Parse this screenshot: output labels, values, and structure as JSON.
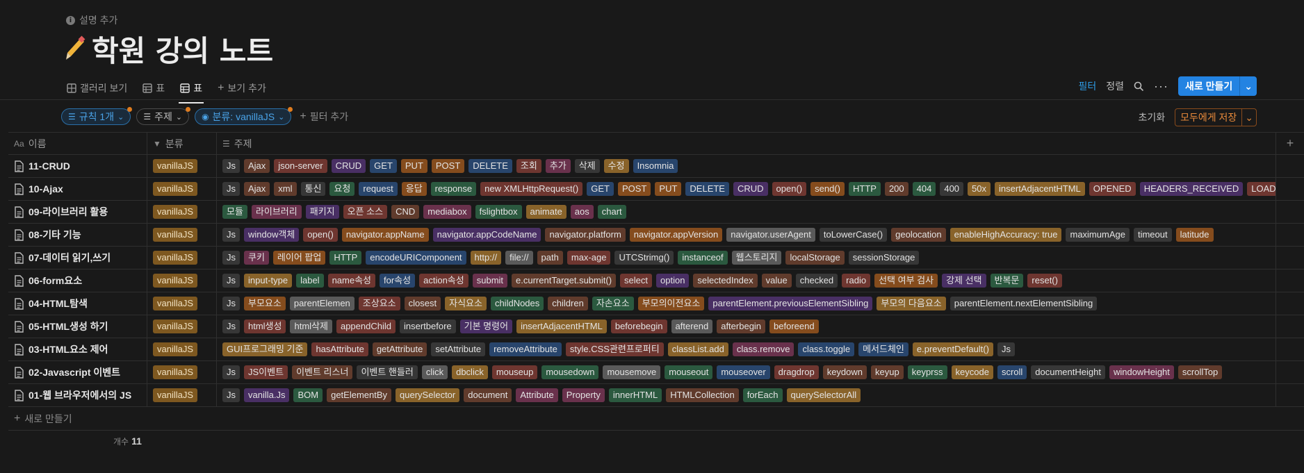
{
  "page": {
    "description_label": "설명 추가",
    "title": "학원 강의 노트"
  },
  "views": {
    "items": [
      {
        "label": "갤러리 보기",
        "icon": "gallery-icon",
        "active": false
      },
      {
        "label": "표",
        "icon": "table-icon",
        "active": false
      },
      {
        "label": "표",
        "icon": "table-icon",
        "active": true
      }
    ],
    "add_view": "보기 추가"
  },
  "toolbar": {
    "filter": "필터",
    "sort": "정렬",
    "new_button": "새로 만들기"
  },
  "filters": {
    "rules": "규칙 1개",
    "topic": "주제",
    "category": "분류: vanillaJS",
    "add_filter": "필터 추가",
    "reset": "초기화",
    "save": "모두에게 저장"
  },
  "table": {
    "headers": {
      "name": "이름",
      "category": "분류",
      "topic": "주제"
    },
    "rows": [
      {
        "name": "11-CRUD",
        "category": "vanillaJS",
        "tags": [
          [
            "Js",
            "default"
          ],
          [
            "Ajax",
            "brown"
          ],
          [
            "json-server",
            "red"
          ],
          [
            "CRUD",
            "purple"
          ],
          [
            "GET",
            "blue"
          ],
          [
            "PUT",
            "orange"
          ],
          [
            "POST",
            "orange"
          ],
          [
            "DELETE",
            "blue"
          ],
          [
            "조회",
            "red"
          ],
          [
            "추가",
            "pink"
          ],
          [
            "삭제",
            "default"
          ],
          [
            "수정",
            "yellow"
          ],
          [
            "Insomnia",
            "blue"
          ]
        ]
      },
      {
        "name": "10-Ajax",
        "category": "vanillaJS",
        "tags": [
          [
            "Js",
            "default"
          ],
          [
            "Ajax",
            "brown"
          ],
          [
            "xml",
            "brown"
          ],
          [
            "통신",
            "default"
          ],
          [
            "요청",
            "green"
          ],
          [
            "request",
            "blue"
          ],
          [
            "응답",
            "orange"
          ],
          [
            "response",
            "green"
          ],
          [
            "new XMLHttpRequest()",
            "red"
          ],
          [
            "GET",
            "blue"
          ],
          [
            "POST",
            "orange"
          ],
          [
            "PUT",
            "orange"
          ],
          [
            "DELETE",
            "blue"
          ],
          [
            "CRUD",
            "purple"
          ],
          [
            "open()",
            "red"
          ],
          [
            "send()",
            "orange"
          ],
          [
            "HTTP",
            "green"
          ],
          [
            "200",
            "brown"
          ],
          [
            "404",
            "green"
          ],
          [
            "400",
            "default"
          ],
          [
            "50x",
            "yellow"
          ],
          [
            "insertAdjacentHTML",
            "yellow"
          ],
          [
            "OPENED",
            "red"
          ],
          [
            "HEADERS_RECEIVED",
            "purple"
          ],
          [
            "LOADING",
            "red"
          ]
        ]
      },
      {
        "name": "09-라이브러리 활용",
        "category": "vanillaJS",
        "tags": [
          [
            "모듈",
            "green"
          ],
          [
            "라이브러리",
            "pink"
          ],
          [
            "패키지",
            "purple"
          ],
          [
            "오픈 소스",
            "red"
          ],
          [
            "CND",
            "brown"
          ],
          [
            "mediabox",
            "pink"
          ],
          [
            "fslightbox",
            "green"
          ],
          [
            "animate",
            "yellow"
          ],
          [
            "aos",
            "pink"
          ],
          [
            "chart",
            "green"
          ]
        ]
      },
      {
        "name": "08-기타 기능",
        "category": "vanillaJS",
        "tags": [
          [
            "Js",
            "default"
          ],
          [
            "window객체",
            "purple"
          ],
          [
            "open()",
            "red"
          ],
          [
            "navigator.appName",
            "orange"
          ],
          [
            "navigator.appCodeName",
            "purple"
          ],
          [
            "navigator.platform",
            "brown"
          ],
          [
            "navigator.appVersion",
            "orange"
          ],
          [
            "navigator.userAgent",
            "gray"
          ],
          [
            "toLowerCase()",
            "default"
          ],
          [
            "geolocation",
            "brown"
          ],
          [
            "enableHighAccuracy: true",
            "yellow"
          ],
          [
            "maximumAge",
            "default"
          ],
          [
            "timeout",
            "default"
          ],
          [
            "latitude",
            "orange"
          ]
        ]
      },
      {
        "name": "07-데이터 읽기,쓰기",
        "category": "vanillaJS",
        "tags": [
          [
            "Js",
            "default"
          ],
          [
            "쿠키",
            "pink"
          ],
          [
            "레이어 팝업",
            "orange"
          ],
          [
            "HTTP",
            "green"
          ],
          [
            "encodeURIComponent",
            "blue"
          ],
          [
            "http://",
            "yellow"
          ],
          [
            "file://",
            "gray"
          ],
          [
            "path",
            "brown"
          ],
          [
            "max-age",
            "red"
          ],
          [
            "UTCStrimg()",
            "default"
          ],
          [
            "instanceof",
            "green"
          ],
          [
            "웹스토리지",
            "gray"
          ],
          [
            "localStorage",
            "brown"
          ],
          [
            "sessionStorage",
            "default"
          ]
        ]
      },
      {
        "name": "06-form요소",
        "category": "vanillaJS",
        "tags": [
          [
            "Js",
            "default"
          ],
          [
            "input-type",
            "yellow"
          ],
          [
            "label",
            "green"
          ],
          [
            "name속성",
            "red"
          ],
          [
            "for속성",
            "blue"
          ],
          [
            "action속성",
            "red"
          ],
          [
            "submit",
            "pink"
          ],
          [
            "e.currentTarget.submit()",
            "brown"
          ],
          [
            "select",
            "red"
          ],
          [
            "option",
            "purple"
          ],
          [
            "selectedIndex",
            "brown"
          ],
          [
            "value",
            "brown"
          ],
          [
            "checked",
            "default"
          ],
          [
            "radio",
            "red"
          ],
          [
            "선택 여부 검사",
            "orange"
          ],
          [
            "강제 선택",
            "purple"
          ],
          [
            "반복문",
            "green"
          ],
          [
            "reset()",
            "red"
          ]
        ]
      },
      {
        "name": "04-HTML탐색",
        "category": "vanillaJS",
        "tags": [
          [
            "Js",
            "default"
          ],
          [
            "부모요소",
            "orange"
          ],
          [
            "parentElemen",
            "gray"
          ],
          [
            "조상요소",
            "red"
          ],
          [
            "closest",
            "brown"
          ],
          [
            "자식요소",
            "yellow"
          ],
          [
            "childNodes",
            "green"
          ],
          [
            "children",
            "brown"
          ],
          [
            "자손요소",
            "green"
          ],
          [
            "부모의이전요소",
            "orange"
          ],
          [
            "parentElement.previousElementSibling",
            "purple"
          ],
          [
            "부모의 다음요소",
            "yellow"
          ],
          [
            "parentElement.nextElementSibling",
            "default"
          ]
        ]
      },
      {
        "name": "05-HTML생성 하기",
        "category": "vanillaJS",
        "tags": [
          [
            "Js",
            "default"
          ],
          [
            "html생성",
            "red"
          ],
          [
            "html삭제",
            "gray"
          ],
          [
            "appendChild",
            "red"
          ],
          [
            "insertbefore",
            "default"
          ],
          [
            "기본 명령어",
            "purple"
          ],
          [
            "insertAdjacentHTML",
            "yellow"
          ],
          [
            "beforebegin",
            "red"
          ],
          [
            "afterend",
            "gray"
          ],
          [
            "afterbegin",
            "brown"
          ],
          [
            "beforeend",
            "orange"
          ]
        ]
      },
      {
        "name": "03-HTML요소 제어",
        "category": "vanillaJS",
        "tags": [
          [
            "GUI프로그래밍 기준",
            "yellow"
          ],
          [
            "hasAttribute",
            "red"
          ],
          [
            "getAttribute",
            "brown"
          ],
          [
            "setAttribute",
            "default"
          ],
          [
            "removeAttribute",
            "blue"
          ],
          [
            "style.CSS관련프로퍼티",
            "red"
          ],
          [
            "classList.add",
            "yellow"
          ],
          [
            "class.remove",
            "pink"
          ],
          [
            "class.toggle",
            "blue"
          ],
          [
            "메서드체인",
            "blue"
          ],
          [
            "e.preventDefault()",
            "yellow"
          ],
          [
            "Js",
            "default"
          ]
        ]
      },
      {
        "name": "02-Javascript 이벤트",
        "category": "vanillaJS",
        "tags": [
          [
            "Js",
            "default"
          ],
          [
            "JS이벤트",
            "red"
          ],
          [
            "이벤트 리스너",
            "brown"
          ],
          [
            "이벤트 핸들러",
            "default"
          ],
          [
            "click",
            "gray"
          ],
          [
            "dbclick",
            "yellow"
          ],
          [
            "mouseup",
            "red"
          ],
          [
            "mousedown",
            "green"
          ],
          [
            "mousemove",
            "gray"
          ],
          [
            "mouseout",
            "green"
          ],
          [
            "mouseover",
            "blue"
          ],
          [
            "dragdrop",
            "red"
          ],
          [
            "keydown",
            "brown"
          ],
          [
            "keyup",
            "brown"
          ],
          [
            "keyprss",
            "green"
          ],
          [
            "keycode",
            "yellow"
          ],
          [
            "scroll",
            "blue"
          ],
          [
            "documentHeight",
            "default"
          ],
          [
            "windowHeight",
            "pink"
          ],
          [
            "scrollTop",
            "brown"
          ]
        ]
      },
      {
        "name": "01-웹 브라우저에서의 JS",
        "category": "vanillaJS",
        "tags": [
          [
            "Js",
            "default"
          ],
          [
            "vanilla.Js",
            "purple"
          ],
          [
            "BOM",
            "green"
          ],
          [
            "getElementBy",
            "brown"
          ],
          [
            "querySelector",
            "yellow"
          ],
          [
            "document",
            "brown"
          ],
          [
            "Attribute",
            "pink"
          ],
          [
            "Property",
            "pink"
          ],
          [
            "innerHTML",
            "green"
          ],
          [
            "HTMLCollection",
            "brown"
          ],
          [
            "forEach",
            "green"
          ],
          [
            "querySelectorAll",
            "yellow"
          ]
        ]
      }
    ],
    "add_row": "새로 만들기",
    "count_label": "개수",
    "count": "11"
  }
}
